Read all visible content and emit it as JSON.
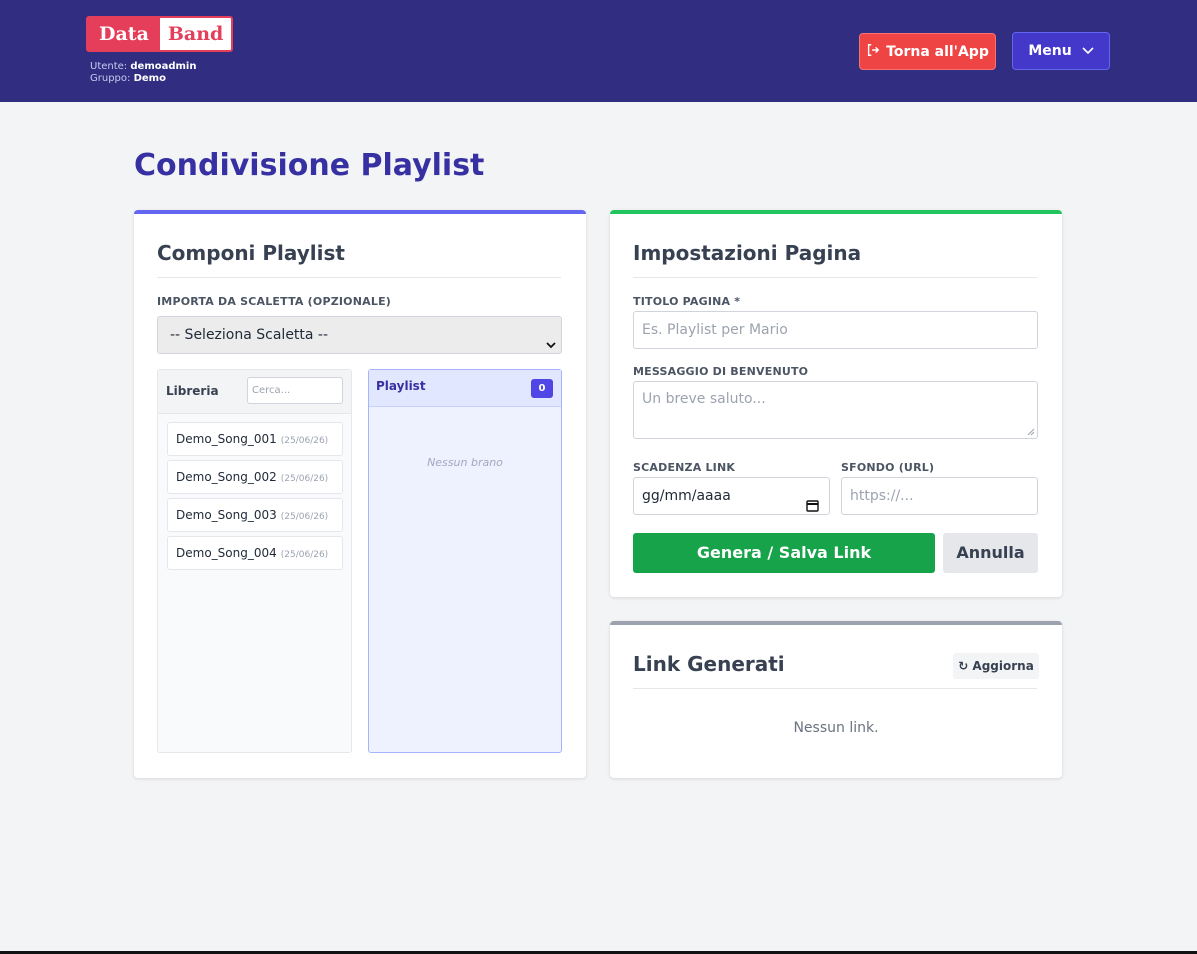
{
  "header": {
    "logo_left": "Data",
    "logo_right": "Band",
    "user_label": "Utente:",
    "user_value": "demoadmin",
    "group_label": "Gruppo:",
    "group_value": "Demo",
    "back_button": "Torna all'App",
    "menu_button": "Menu"
  },
  "page": {
    "title": "Condivisione Playlist"
  },
  "compose": {
    "title": "Componi Playlist",
    "import_label": "IMPORTA DA SCALETTA (OPZIONALE)",
    "import_selected": "-- Seleziona Scaletta --",
    "library": {
      "title": "Libreria",
      "search_placeholder": "Cerca...",
      "songs": [
        {
          "name": "Demo_Song_001",
          "date": "(25/06/26)"
        },
        {
          "name": "Demo_Song_002",
          "date": "(25/06/26)"
        },
        {
          "name": "Demo_Song_003",
          "date": "(25/06/26)"
        },
        {
          "name": "Demo_Song_004",
          "date": "(25/06/26)"
        }
      ]
    },
    "playlist": {
      "title": "Playlist",
      "count": "0",
      "empty": "Nessun brano"
    }
  },
  "settings": {
    "title": "Impostazioni Pagina",
    "title_label": "TITOLO PAGINA *",
    "title_placeholder": "Es. Playlist per Mario",
    "welcome_label": "MESSAGGIO DI BENVENUTO",
    "welcome_placeholder": "Un breve saluto...",
    "expiry_label": "SCADENZA LINK",
    "expiry_value": "gg/mm/aaaa",
    "bg_label": "SFONDO (URL)",
    "bg_placeholder": "https://...",
    "generate_button": "Genera / Salva Link",
    "cancel_button": "Annulla"
  },
  "links": {
    "title": "Link Generati",
    "refresh_button": "↻ Aggiorna",
    "empty": "Nessun link."
  },
  "colors": {
    "header_bg": "#312e81",
    "accent": "#3730a3",
    "brand_red": "#e53e5a",
    "green": "#16a34a"
  }
}
